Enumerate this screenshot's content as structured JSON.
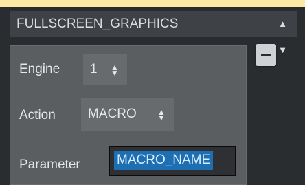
{
  "preset": {
    "value": "FULLSCREEN_GRAPHICS",
    "arrows_icon": "up-down-chevrons-icon"
  },
  "panel": {
    "remove_icon": "minus-icon",
    "engine": {
      "label": "Engine",
      "value": "1"
    },
    "action": {
      "label": "Action",
      "value": "MACRO"
    },
    "parameter": {
      "label": "Parameter",
      "value": "MACRO_NAME"
    }
  },
  "colors": {
    "accent_bar": "#fbeaa5",
    "selection": "#1e6fb2"
  }
}
